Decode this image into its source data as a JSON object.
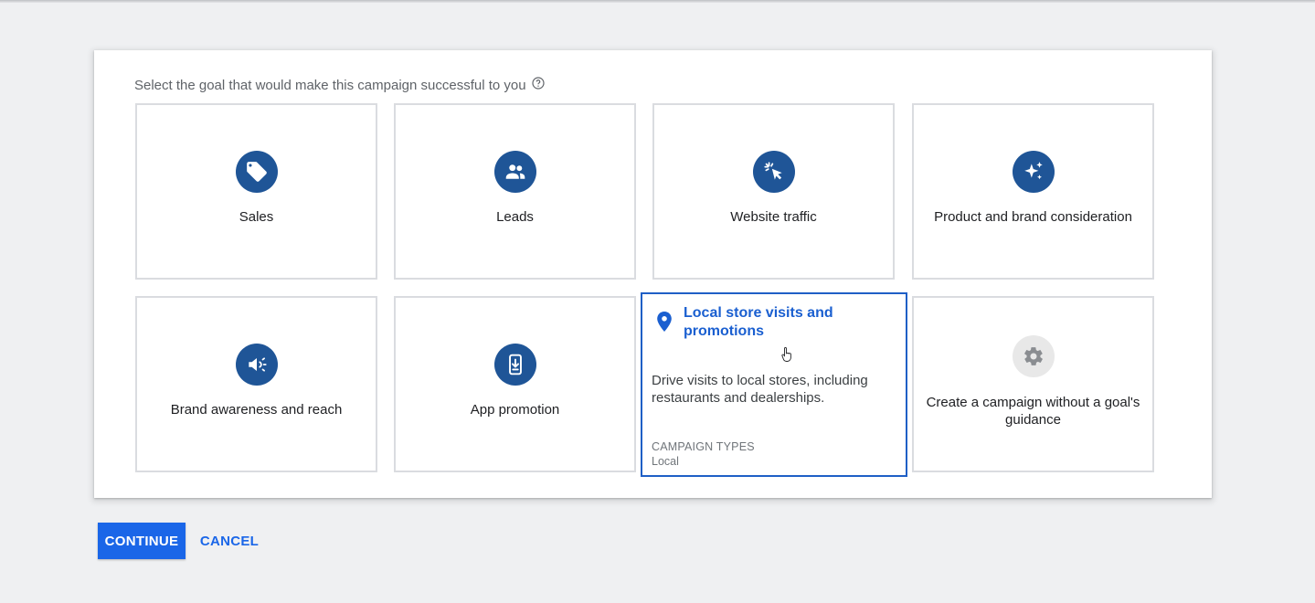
{
  "prompt": {
    "text": "Select the goal that would make this campaign successful to you",
    "help_icon": "help-circle-icon"
  },
  "goals": [
    {
      "label": "Sales",
      "icon": "tag-icon"
    },
    {
      "label": "Leads",
      "icon": "people-icon"
    },
    {
      "label": "Website traffic",
      "icon": "cursor-click-icon"
    },
    {
      "label": "Product and brand consideration",
      "icon": "sparkle-icon"
    },
    {
      "label": "Brand awareness and reach",
      "icon": "speaker-icon"
    },
    {
      "label": "App promotion",
      "icon": "phone-download-icon"
    },
    {
      "label": "Local store visits and promotions",
      "icon": "map-pin-icon",
      "selected": true,
      "description": "Drive visits to local stores, including restaurants and dealerships.",
      "campaign_types_label": "CAMPAIGN TYPES",
      "campaign_types_value": "Local"
    },
    {
      "label": "Create a campaign without a goal's guidance",
      "icon": "gear-icon"
    }
  ],
  "actions": {
    "continue_label": "CONTINUE",
    "cancel_label": "CANCEL"
  },
  "colors": {
    "accent": "#1a66e8",
    "icon_bg": "#1f5597",
    "selected_border": "#1f5fc6",
    "card_border": "#dadce0",
    "page_bg": "#eff0f2"
  }
}
